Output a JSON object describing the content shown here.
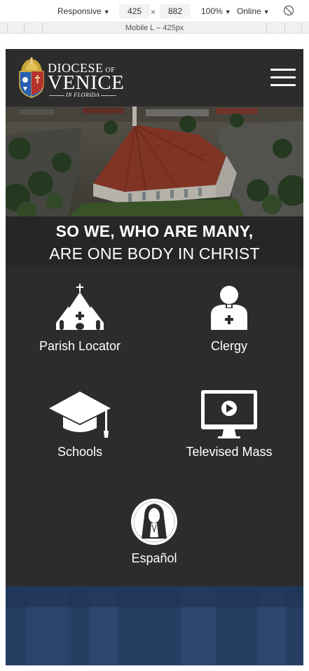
{
  "devtools": {
    "device": "Responsive",
    "width": "425",
    "times": "×",
    "height": "882",
    "zoom": "100%",
    "network": "Online",
    "ruler_label": "Mobile L – 425px"
  },
  "header": {
    "logo_line1": "DIOCESE",
    "logo_of": "OF",
    "logo_line2": "VENICE",
    "logo_line3": "IN FLORIDA"
  },
  "tagline": {
    "line1": "SO WE, WHO ARE MANY,",
    "line2": "ARE ONE BODY IN CHRIST"
  },
  "quick_links": [
    {
      "label": "Parish Locator",
      "icon": "church-icon"
    },
    {
      "label": "Clergy",
      "icon": "priest-icon"
    },
    {
      "label": "Schools",
      "icon": "graduation-cap-icon"
    },
    {
      "label": "Televised Mass",
      "icon": "monitor-play-icon"
    },
    {
      "label": "Español",
      "icon": "our-lady-medallion-icon"
    }
  ],
  "colors": {
    "header_bg": "#2c2c2c",
    "tagline_bg": "#262626",
    "text": "#ffffff",
    "roof": "#a4432f"
  }
}
